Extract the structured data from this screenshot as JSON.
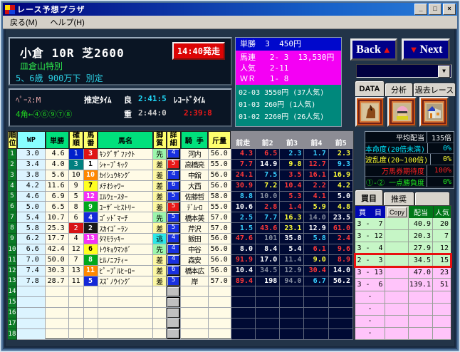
{
  "window": {
    "title": "レース予想プラザ",
    "minimize": "_",
    "maximize": "□",
    "close": "×"
  },
  "menu": {
    "items": [
      {
        "label": "戻る(M)"
      },
      {
        "label": "ヘルプ(H)"
      }
    ]
  },
  "race": {
    "title": "小倉 10R  芝2600",
    "start_time": "14:40発走",
    "race_name": "皿倉山特別",
    "conditions": "5、6歳 900万下 別定"
  },
  "pace": {
    "pace": "ﾍﾟｰｽ:M",
    "estimated_label": "推定ﾀｲﾑ",
    "good_label": "良",
    "good_time": "2:41:5",
    "record_label": "ﾚｺｰﾄﾞﾀｲﾑ",
    "corner": "4角←④⑥⑨⑦⑧",
    "heavy_label": "重",
    "heavy_time": "2:44:0",
    "record_time": "2:39:8"
  },
  "results": {
    "win": "単勝  3  450円",
    "quinella": "馬連   2- 3  13,530円",
    "ninki": "人気   2-11",
    "wr": "ＷＲ   1- 8",
    "wide": [
      "02-03 3550円 (37人気)",
      "01-03 260円 (1人気)",
      "01-02 2260円 (26人気)"
    ]
  },
  "nav": {
    "back": "Back",
    "back_arrow": "▲",
    "next": "Next",
    "next_arrow": "▼"
  },
  "combo": {
    "value": "",
    "arrow": "▼"
  },
  "tabs": {
    "data": "DATA",
    "analysis": "分析",
    "past": "過去レース"
  },
  "stats": {
    "rows": [
      {
        "label": "平均配当",
        "value": "135倍",
        "color": "#ffffff"
      },
      {
        "label": "本命度(20倍未満)",
        "value": "0%",
        "color": "#00e8ff"
      },
      {
        "label": "波乱度(20~100倍)",
        "value": "0%",
        "color": "#ffff30"
      },
      {
        "label": "万馬券期待度",
        "value": "100%",
        "color": "#ff2020"
      },
      {
        "label": "①-② 一点勝負度",
        "value": "0%",
        "color": "#20e820"
      }
    ]
  },
  "bet": {
    "tabs": [
      "買目",
      "推奨"
    ],
    "headers": {
      "kaime": "買  目",
      "copy": "Copy",
      "payout": "配当",
      "ninki": "人気"
    },
    "rows": [
      {
        "kaime": "3 -  7",
        "payout": "40.9",
        "ninki": "20",
        "bg": "green"
      },
      {
        "kaime": "3 - 12",
        "payout": "20.3",
        "ninki": "7",
        "bg": "green"
      },
      {
        "kaime": "3 -  4",
        "payout": "27.9",
        "ninki": "12",
        "bg": "green"
      },
      {
        "kaime": "2 -  3",
        "payout": "34.5",
        "ninki": "15",
        "bg": "green",
        "hl": true
      },
      {
        "kaime": "3 - 13",
        "payout": "47.0",
        "ninki": "23",
        "bg": "pink"
      },
      {
        "kaime": "3 -  6",
        "payout": "139.1",
        "ninki": "51",
        "bg": "pink"
      },
      {
        "kaime": "-",
        "payout": "",
        "ninki": "",
        "bg": "pink"
      },
      {
        "kaime": "-",
        "payout": "",
        "ninki": "",
        "bg": "pink"
      },
      {
        "kaime": "-",
        "payout": "",
        "ninki": "",
        "bg": "pink"
      },
      {
        "kaime": "-",
        "payout": "",
        "ninki": "",
        "bg": "pink"
      }
    ]
  },
  "table": {
    "headers": {
      "rank": "順位",
      "wp": "WP",
      "win": "単勝",
      "ko": "確順",
      "num": "馬番",
      "name": "馬名",
      "style": "脚質",
      "detail": "詳細",
      "jockey": "騎 手",
      "weight": "斤量"
    },
    "prev_headers": [
      "前走",
      "前2",
      "前3",
      "前4",
      "前5"
    ],
    "rows": [
      {
        "rank": "1",
        "wp": "3.0",
        "win": "4.6",
        "ko": "1",
        "ko_bg": "first",
        "num": "3",
        "frame": 3,
        "name": "ｷﾝｸﾞｻﾞﾌｧｸﾄ",
        "style": "先",
        "style_type": "sen",
        "detail": "4",
        "detail_color": "blue",
        "jockey": "河内",
        "weight": "56.0",
        "prev": [
          {
            "v": "4.3",
            "c": "red"
          },
          {
            "v": "6.5",
            "c": "red"
          },
          {
            "v": "2.3",
            "c": "cyan"
          },
          {
            "v": "1.7",
            "c": "cyan"
          },
          {
            "v": "2.3",
            "c": "yellow"
          }
        ]
      },
      {
        "rank": "2",
        "wp": "3.4",
        "win": "4.0",
        "ko": "3",
        "ko_bg": "third",
        "num": "1",
        "frame": 1,
        "name": "ｼｬｰﾌﾟｷｯｸ",
        "style": "差",
        "style_type": "sa",
        "detail": "5",
        "detail_color": "red",
        "jockey": "高橋亮",
        "weight": "55.0",
        "prev": [
          {
            "v": "7.7",
            "c": "red"
          },
          {
            "v": "14.9",
            "c": "white"
          },
          {
            "v": "9.8",
            "c": "yellow"
          },
          {
            "v": "12.7",
            "c": "red"
          },
          {
            "v": "9.3",
            "c": "cyan"
          }
        ]
      },
      {
        "rank": "3",
        "wp": "3.8",
        "win": "5.6",
        "ko": "10",
        "num": "10",
        "frame": 7,
        "name": "ｶｲｼｭｳｷﾝｸﾞ",
        "style": "差",
        "style_type": "sa",
        "detail": "4",
        "detail_color": "blue",
        "jockey": "中舘",
        "weight": "56.0",
        "prev": [
          {
            "v": "24.1",
            "c": "red"
          },
          {
            "v": "7.5",
            "c": "cyan"
          },
          {
            "v": "3.5",
            "c": "red"
          },
          {
            "v": "16.1",
            "c": "red"
          },
          {
            "v": "16.9",
            "c": "yellow"
          }
        ]
      },
      {
        "rank": "4",
        "wp": "4.2",
        "win": "11.6",
        "ko": "9",
        "num": "7",
        "frame": 5,
        "name": "ﾒﾃｵｼｬﾜｰ",
        "style": "差",
        "style_type": "sa",
        "detail": "6",
        "detail_color": "blue",
        "jockey": "大西",
        "weight": "56.0",
        "prev": [
          {
            "v": "30.9",
            "c": "red"
          },
          {
            "v": "7.2",
            "c": "yellow"
          },
          {
            "v": "10.4",
            "c": "red"
          },
          {
            "v": "2.2",
            "c": "red"
          },
          {
            "v": "4.2",
            "c": "yellow"
          }
        ]
      },
      {
        "rank": "5",
        "wp": "4.6",
        "win": "6.9",
        "ko": "5",
        "num": "12",
        "frame": 8,
        "name": "ｴﾙｳｪｰｽﾀｰ",
        "style": "差",
        "style_type": "sa",
        "detail": "5",
        "detail_color": "blue",
        "jockey": "佐藤哲",
        "weight": "58.0",
        "prev": [
          {
            "v": "8.8",
            "c": "cyan"
          },
          {
            "v": "10.0",
            "c": "gray"
          },
          {
            "v": "5.3",
            "c": "red"
          },
          {
            "v": "4.1",
            "c": "red"
          },
          {
            "v": "5.0",
            "c": "white"
          }
        ]
      },
      {
        "rank": "6",
        "wp": "5.0",
        "win": "6.5",
        "ko": "8",
        "num": "9",
        "frame": 6,
        "name": "ﾕｰｻﾞｰﾋｽﾄﾘｰ",
        "style": "差",
        "style_type": "sa",
        "detail": "5",
        "detail_color": "red",
        "jockey": "ﾃﾞﾑｰﾛ",
        "weight": "55.0",
        "prev": [
          {
            "v": "10.6",
            "c": "white"
          },
          {
            "v": "2.8",
            "c": "red"
          },
          {
            "v": "1.4",
            "c": "red"
          },
          {
            "v": "5.9",
            "c": "yellow"
          },
          {
            "v": "4.8",
            "c": "yellow"
          }
        ]
      },
      {
        "rank": "7",
        "wp": "5.4",
        "win": "10.7",
        "ko": "6",
        "num": "4",
        "frame": 4,
        "name": "ｺﾞｯﾄﾞﾏｰﾁ",
        "style": "先",
        "style_type": "sen",
        "detail": "5",
        "detail_color": "blue",
        "jockey": "橋本美",
        "weight": "57.0",
        "prev": [
          {
            "v": "2.5",
            "c": "cyan"
          },
          {
            "v": "7.7",
            "c": "cyan"
          },
          {
            "v": "16.3",
            "c": "yellow"
          },
          {
            "v": "14.0",
            "c": "gray"
          },
          {
            "v": "23.5",
            "c": "white"
          }
        ]
      },
      {
        "rank": "8",
        "wp": "5.8",
        "win": "25.3",
        "ko": "2",
        "ko_bg": "second",
        "num": "2",
        "frame": 2,
        "name": "ｽｶｲｺﾞｰﾗﾝ",
        "style": "差",
        "style_type": "sa",
        "detail": "5",
        "detail_color": "blue",
        "jockey": "芹沢",
        "weight": "57.0",
        "prev": [
          {
            "v": "1.5",
            "c": "cyan"
          },
          {
            "v": "43.6",
            "c": "red"
          },
          {
            "v": "23.1",
            "c": "yellow"
          },
          {
            "v": "12.9",
            "c": "white"
          },
          {
            "v": "61.0",
            "c": "red"
          }
        ]
      },
      {
        "rank": "9",
        "wp": "6.2",
        "win": "17.7",
        "ko": "4",
        "num": "13",
        "frame": 8,
        "name": "ﾀﾏﾓﾗｯｷｰ",
        "style": "逃",
        "style_type": "nige",
        "detail": "4",
        "detail_color": "blue",
        "jockey": "飯田",
        "weight": "56.0",
        "prev": [
          {
            "v": "47.6",
            "c": "red"
          },
          {
            "v": "101",
            "c": "gray"
          },
          {
            "v": "35.8",
            "c": "white"
          },
          {
            "v": "5.8",
            "c": "cyan"
          },
          {
            "v": "2.4",
            "c": "red"
          }
        ]
      },
      {
        "rank": "10",
        "wp": "6.6",
        "win": "42.4",
        "ko": "12",
        "num": "6",
        "frame": 5,
        "name": "ﾄｳｷｮｳﾏﾝﾎﾞ",
        "style": "先",
        "style_type": "sen",
        "detail": "4",
        "detail_color": "blue",
        "jockey": "中谷",
        "weight": "56.0",
        "prev": [
          {
            "v": "8.0",
            "c": "white"
          },
          {
            "v": "8.4",
            "c": "white"
          },
          {
            "v": "5.4",
            "c": "white"
          },
          {
            "v": "6.1",
            "c": "red"
          },
          {
            "v": "9.6",
            "c": "red"
          }
        ]
      },
      {
        "rank": "11",
        "wp": "7.0",
        "win": "50.0",
        "ko": "7",
        "num": "8",
        "frame": 6,
        "name": "ﾋﾙﾉﾆﾌﾃｨｰ",
        "style": "差",
        "style_type": "sa",
        "detail": "4",
        "detail_color": "blue",
        "jockey": "森安",
        "weight": "56.0",
        "prev": [
          {
            "v": "91.9",
            "c": "red"
          },
          {
            "v": "17.0",
            "c": "white"
          },
          {
            "v": "11.4",
            "c": "gray"
          },
          {
            "v": "9.0",
            "c": "yellow"
          },
          {
            "v": "8.9",
            "c": "red"
          }
        ]
      },
      {
        "rank": "12",
        "wp": "7.4",
        "win": "30.3",
        "ko": "13",
        "num": "11",
        "frame": 7,
        "name": "ﾋﾟｰﾌﾟﾙﾋｰﾛｰ",
        "style": "差",
        "style_type": "sa",
        "detail": "6",
        "detail_color": "blue",
        "jockey": "橋本広",
        "weight": "56.0",
        "prev": [
          {
            "v": "10.4",
            "c": "white"
          },
          {
            "v": "34.5",
            "c": "gray"
          },
          {
            "v": "12.9",
            "c": "gray"
          },
          {
            "v": "30.4",
            "c": "red"
          },
          {
            "v": "14.0",
            "c": "white"
          }
        ]
      },
      {
        "rank": "13",
        "wp": "7.8",
        "win": "28.7",
        "ko": "11",
        "num": "5",
        "frame": 4,
        "name": "ｽｽﾞﾉｳｲﾝｸﾞ",
        "style": "差",
        "style_type": "sa",
        "detail": "5",
        "detail_color": "blue",
        "jockey": "岸",
        "weight": "57.0",
        "prev": [
          {
            "v": "89.4",
            "c": "red"
          },
          {
            "v": "198",
            "c": "white"
          },
          {
            "v": "94.0",
            "c": "gray"
          },
          {
            "v": "6.7",
            "c": "cyan"
          },
          {
            "v": "56.2",
            "c": "white"
          }
        ]
      },
      {
        "rank": "14",
        "empty": true
      },
      {
        "rank": "15",
        "empty": true
      },
      {
        "rank": "16",
        "empty": true
      },
      {
        "rank": "17",
        "empty": true
      },
      {
        "rank": "18",
        "empty": true
      }
    ]
  }
}
